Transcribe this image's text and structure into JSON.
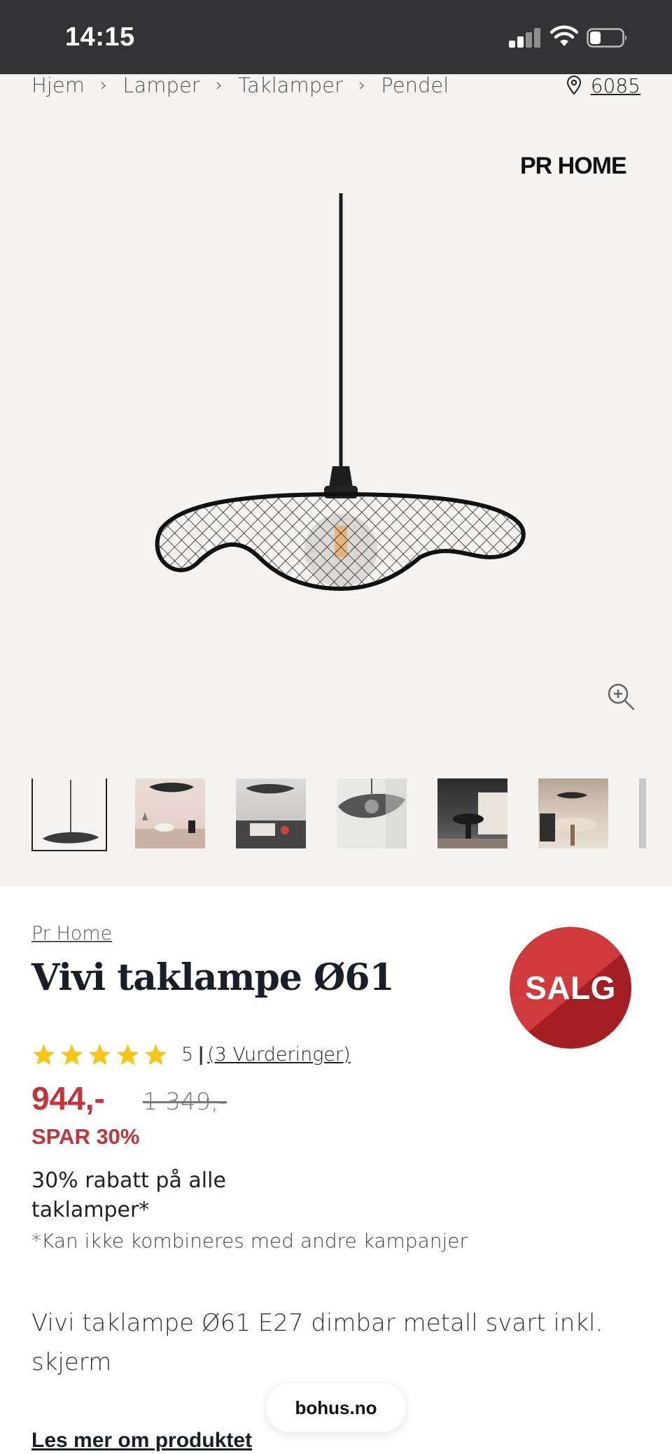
{
  "status_bar": {
    "time": "14:15",
    "icons": [
      "cellular-signal-icon",
      "wifi-icon",
      "battery-icon"
    ]
  },
  "breadcrumb": {
    "items": [
      "Hjem",
      "Lamper",
      "Taklamper",
      "Pendel"
    ],
    "separator_icon": "chevron-right-icon"
  },
  "location": {
    "icon": "location-pin-icon",
    "zip": "6085"
  },
  "gallery": {
    "brand_logo": "PR HOME",
    "zoom_icon": "zoom-in-icon",
    "thumbnail_count_visible": 7,
    "active_thumbnail": 1
  },
  "product": {
    "brand": "Pr Home",
    "title": "Vivi taklampe Ø61",
    "sale_badge": "SALG",
    "rating": {
      "score": "5",
      "stars": 5,
      "separator": "|",
      "reviews": "(3 Vurderinger)"
    },
    "price": "944,-",
    "old_price": "1 349,-",
    "save": "SPAR 30%",
    "promo": "30% rabatt på alle taklamper*",
    "promo_note": "*Kan ikke kombineres med andre kampanjer",
    "description": "Vivi taklampe Ø61 E27 dimbar metall svart inkl. skjerm",
    "read_more": "Les mer om produktet"
  },
  "browser": {
    "domain": "bohus.no"
  },
  "colors": {
    "sale_red": "#c2353a",
    "star_yellow": "#f5c518",
    "status_bar": "#333336",
    "gallery_bg": "#f4f3f1",
    "title_navy": "#1a1e29"
  }
}
